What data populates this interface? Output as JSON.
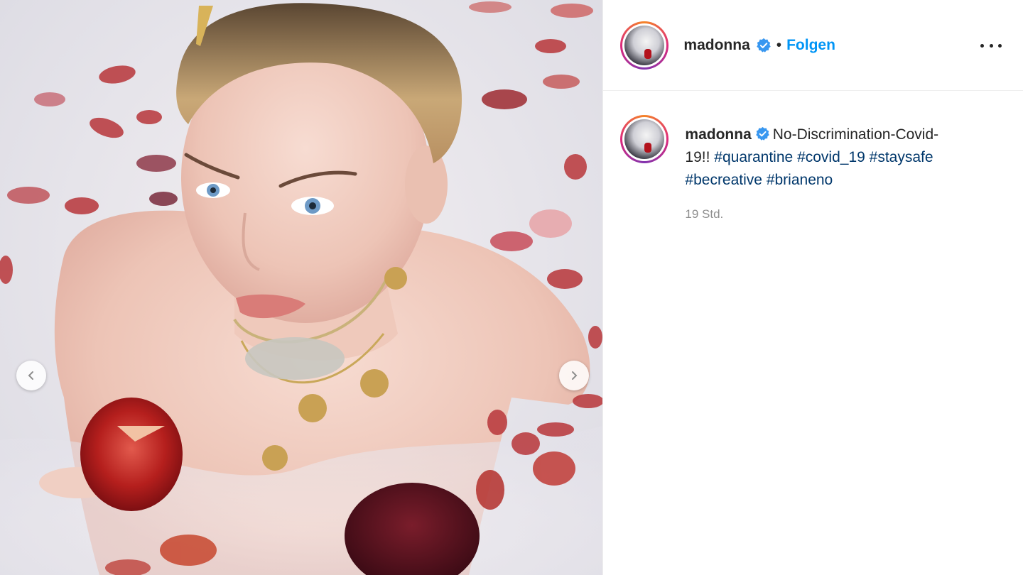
{
  "post": {
    "username": "madonna",
    "separator": "•",
    "follow_label": "Folgen",
    "more_icon": "more-horizontal-icon",
    "verified_icon": "verified-badge-icon",
    "verified_color": "#3897f0",
    "follow_color": "#0095f6",
    "hashtag_color": "#00376b"
  },
  "caption": {
    "username": "madonna",
    "text": "No-Discrimination-Covid-19!!",
    "hashtags": [
      "#quarantine",
      "#covid_19",
      "#staysafe",
      "#becreative",
      "#brianeno"
    ],
    "time": "19 Std."
  },
  "media": {
    "prev_icon": "chevron-left-icon",
    "next_icon": "chevron-right-icon"
  }
}
